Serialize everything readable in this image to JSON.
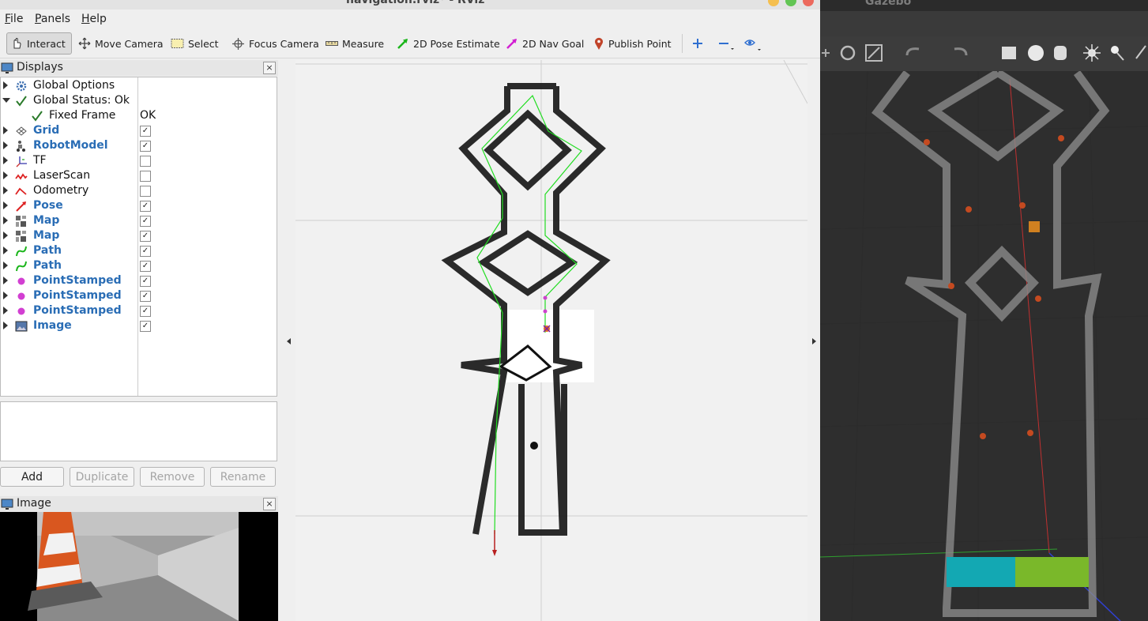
{
  "rviz": {
    "window_title": "navigation.rviz* - RViz",
    "menu": [
      {
        "label": "File",
        "key": "F",
        "rest": "ile"
      },
      {
        "label": "Panels",
        "key": "P",
        "rest": "anels"
      },
      {
        "label": "Help",
        "key": "H",
        "rest": "elp"
      }
    ],
    "toolbar": {
      "interact": "Interact",
      "move_camera": "Move Camera",
      "select": "Select",
      "focus_camera": "Focus Camera",
      "measure": "Measure",
      "pose_estimate": "2D Pose Estimate",
      "nav_goal": "2D Nav Goal",
      "publish_point": "Publish Point"
    },
    "displays_panel": {
      "title": "Displays",
      "items": [
        {
          "label": "Global Options",
          "icon": "gear-icon",
          "checked": null,
          "value": ""
        },
        {
          "label": "Global Status: Ok",
          "icon": "check-icon",
          "checked": null,
          "value": ""
        },
        {
          "label": "Fixed Frame",
          "icon": "check-icon",
          "checked": null,
          "value": "OK"
        },
        {
          "label": "Grid",
          "icon": "grid-icon",
          "checked": true,
          "value": ""
        },
        {
          "label": "RobotModel",
          "icon": "robot-icon",
          "checked": true,
          "value": ""
        },
        {
          "label": "TF",
          "icon": "axes-icon",
          "checked": false,
          "value": ""
        },
        {
          "label": "LaserScan",
          "icon": "laser-icon",
          "checked": false,
          "value": ""
        },
        {
          "label": "Odometry",
          "icon": "odometry-icon",
          "checked": false,
          "value": ""
        },
        {
          "label": "Pose",
          "icon": "pose-arrow-icon",
          "checked": true,
          "value": ""
        },
        {
          "label": "Map",
          "icon": "map-icon",
          "checked": true,
          "value": ""
        },
        {
          "label": "Map",
          "icon": "map-icon",
          "checked": true,
          "value": ""
        },
        {
          "label": "Path",
          "icon": "path-icon",
          "checked": true,
          "value": ""
        },
        {
          "label": "Path",
          "icon": "path-icon",
          "checked": true,
          "value": ""
        },
        {
          "label": "PointStamped",
          "icon": "point-icon",
          "checked": true,
          "value": ""
        },
        {
          "label": "PointStamped",
          "icon": "point-icon",
          "checked": true,
          "value": ""
        },
        {
          "label": "PointStamped",
          "icon": "point-icon",
          "checked": true,
          "value": ""
        },
        {
          "label": "Image",
          "icon": "image-icon",
          "checked": true,
          "value": ""
        }
      ],
      "buttons": {
        "add": "Add",
        "duplicate": "Duplicate",
        "remove": "Remove",
        "rename": "Rename"
      }
    },
    "image_panel": {
      "title": "Image"
    }
  },
  "gazebo": {
    "window_title": "Gazebo"
  },
  "colors": {
    "path_green": "#22dd22",
    "wall_black": "#1a1a1a",
    "point_magenta": "#cc44cc",
    "link_blue": "#2a6db5"
  }
}
